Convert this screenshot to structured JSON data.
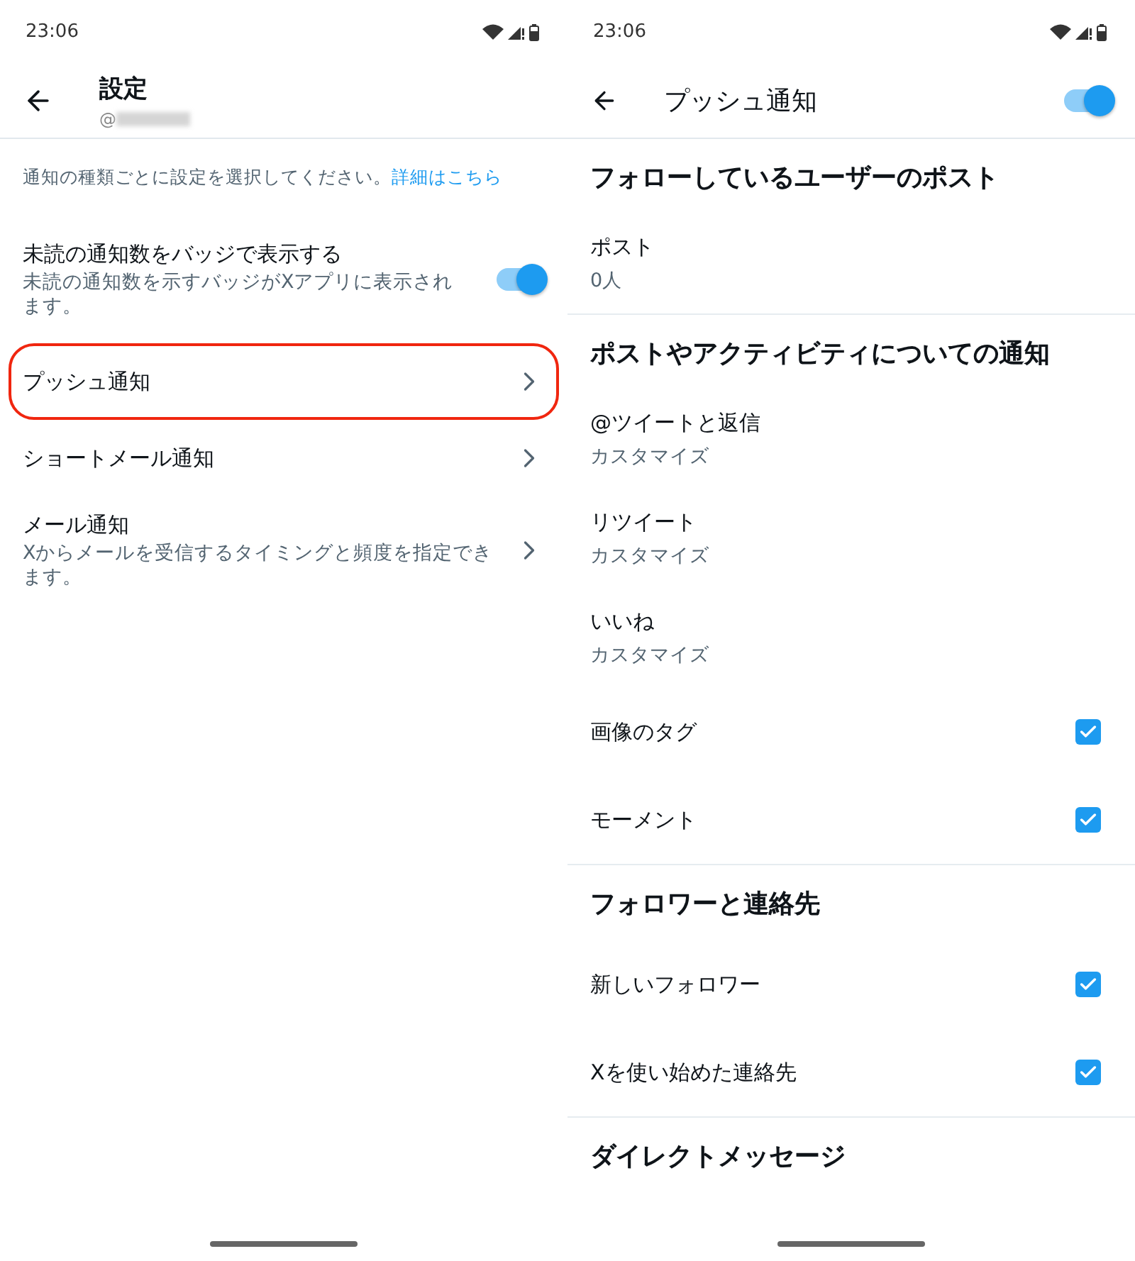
{
  "left_screen": {
    "status_bar": {
      "time": "23:06"
    },
    "header": {
      "title": "設定",
      "username": "@"
    },
    "description": {
      "text": "通知の種類ごとに設定を選択してください。",
      "link": "詳細はこちら"
    },
    "items": [
      {
        "kind": "toggle",
        "label": "未読の通知数をバッジで表示する",
        "description": "未読の通知数を示すバッジがXアプリに表示されます。",
        "on": true,
        "highlighted": false
      },
      {
        "kind": "link",
        "label": "プッシュ通知",
        "highlighted": true
      },
      {
        "kind": "link",
        "label": "ショートメール通知",
        "highlighted": false
      },
      {
        "kind": "link",
        "label": "メール通知",
        "description": "Xからメールを受信するタイミングと頻度を指定できます。",
        "highlighted": false
      }
    ]
  },
  "right_screen": {
    "status_bar": {
      "time": "23:06"
    },
    "header": {
      "title": "プッシュ通知",
      "on": true
    },
    "sections": [
      {
        "heading": "フォローしているユーザーのポスト",
        "items": [
          {
            "kind": "link",
            "label": "ポスト",
            "value": "0人"
          }
        ]
      },
      {
        "heading": "ポストやアクティビティについての通知",
        "items": [
          {
            "kind": "link",
            "label": "@ツイートと返信",
            "value": "カスタマイズ"
          },
          {
            "kind": "link",
            "label": "リツイート",
            "value": "カスタマイズ"
          },
          {
            "kind": "link",
            "label": "いいね",
            "value": "カスタマイズ"
          },
          {
            "kind": "check",
            "label": "画像のタグ",
            "checked": true
          },
          {
            "kind": "check",
            "label": "モーメント",
            "checked": true
          }
        ]
      },
      {
        "heading": "フォロワーと連絡先",
        "items": [
          {
            "kind": "check",
            "label": "新しいフォロワー",
            "checked": true
          },
          {
            "kind": "check",
            "label": "Xを使い始めた連絡先",
            "checked": true
          }
        ]
      },
      {
        "heading": "ダイレクトメッセージ"
      }
    ]
  }
}
